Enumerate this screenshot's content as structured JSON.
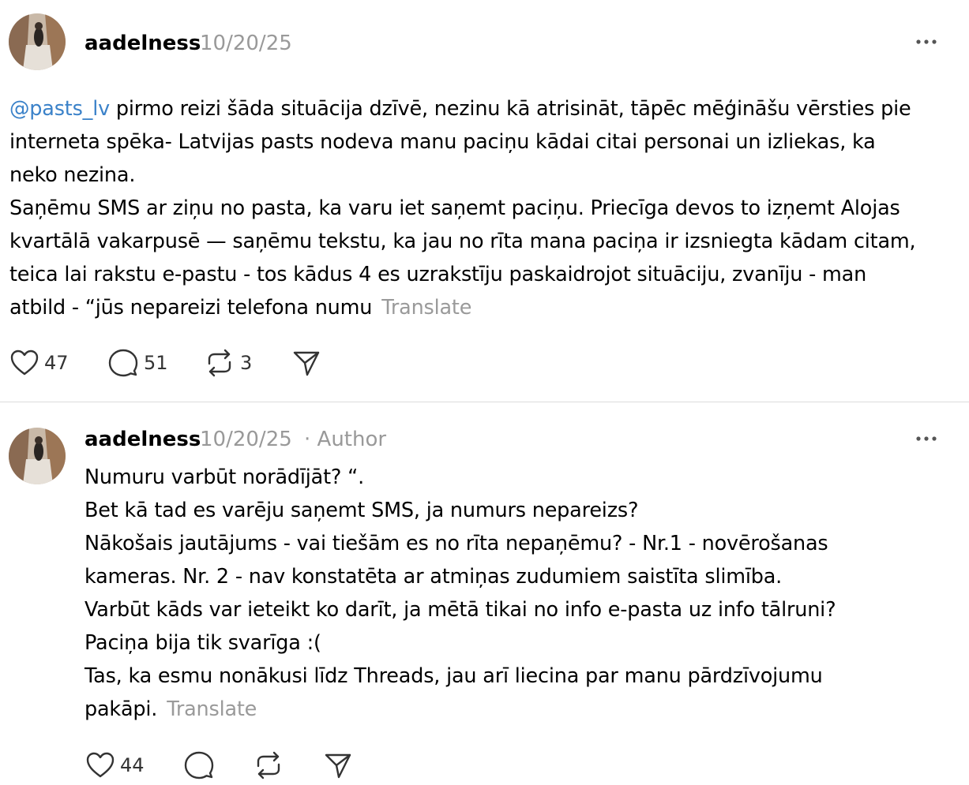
{
  "posts": [
    {
      "username": "aadelness",
      "date": "10/20/25",
      "author_badge": "",
      "mention": "@pasts_lv",
      "lines": [
        " pirmo reizi šāda situācija dzīvē, nezinu kā atrisināt, tāpēc mēģināšu vērsties pie",
        "interneta spēka- Latvijas pasts nodeva manu paciņu kādai citai personai un izliekas, ka",
        "neko nezina.",
        "Saņēmu SMS ar ziņu no pasta, ka varu iet saņemt paciņu. Priecīga devos to izņemt Alojas",
        "kvartālā vakarpusē — saņēmu tekstu, ka jau no rīta mana paciņa ir izsniegta kādam citam,",
        "teica lai rakstu e-pastu - tos kādus 4 es uzrakstīju paskaidrojot situāciju, zvanīju - man",
        "atbild - “jūs nepareizi telefona numu"
      ],
      "translate_label": "Translate",
      "likes": "47",
      "replies": "51",
      "reposts": "3",
      "icons": [
        "heart-icon",
        "comment-icon",
        "repost-icon",
        "share-icon",
        "more-icon"
      ]
    },
    {
      "username": "aadelness",
      "date": "10/20/25",
      "author_badge": "· Author",
      "lines": [
        "Numuru varbūt norādījāt? “.",
        "Bet kā tad es varēju saņemt SMS, ja numurs nepareizs?",
        "Nākošais jautājums - vai tiešām es no rīta nepaņēmu? - Nr.1 - novērošanas",
        "kameras. Nr. 2 - nav konstatēta ar atmiņas zudumiem saistīta slimība.",
        "Varbūt kāds var ieteikt ko darīt, ja mētā tikai no info e-pasta uz info tālruni?",
        "Paciņa bija tik svarīga :(",
        "Tas, ka esmu nonākusi līdz Threads, jau arī liecina par manu pārdzīvojumu",
        "pakāpi."
      ],
      "translate_label": "Translate",
      "likes": "44",
      "replies": "",
      "reposts": "",
      "icons": [
        "heart-icon",
        "comment-icon",
        "repost-icon",
        "share-icon",
        "more-icon"
      ]
    }
  ],
  "colors": {
    "mention": "#3b82c9",
    "muted": "#999999",
    "divider": "#dcdcdc"
  }
}
